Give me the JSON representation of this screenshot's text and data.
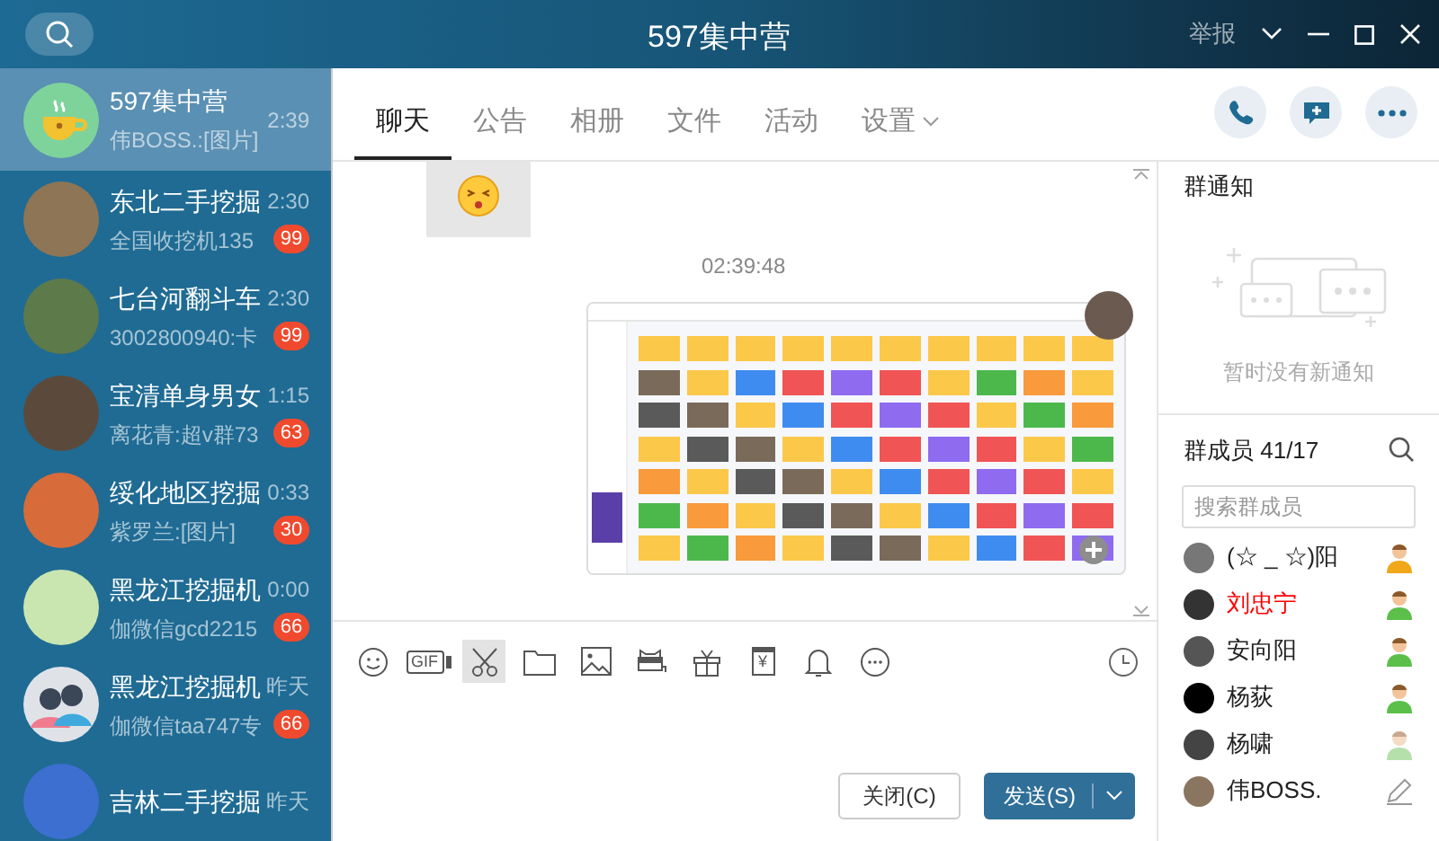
{
  "window": {
    "title": "597集中营",
    "report": "举报"
  },
  "conversations": [
    {
      "name": "597集中营",
      "time": "2:39",
      "preview": "伟BOSS.:[图片]",
      "selected": true,
      "kind": "cup"
    },
    {
      "name": "东北二手挖掘",
      "time": "2:30",
      "preview": "全国收挖机135",
      "badge": "99",
      "selected": false,
      "kind": "photo"
    },
    {
      "name": "七台河翻斗车",
      "time": "2:30",
      "preview": "3002800940:卡",
      "badge": "99",
      "selected": false,
      "kind": "photo"
    },
    {
      "name": "宝清单身男女",
      "time": "1:15",
      "preview": "离花青:超v群73",
      "badge": "63",
      "selected": false,
      "kind": "photo"
    },
    {
      "name": "绥化地区挖掘",
      "time": "0:33",
      "preview": "紫罗兰:[图片]",
      "badge": "30",
      "selected": false,
      "kind": "photo"
    },
    {
      "name": "黑龙江挖掘机",
      "time": "0:00",
      "preview": "伽微信gcd2215",
      "badge": "66",
      "selected": false,
      "kind": "photo"
    },
    {
      "name": "黑龙江挖掘机",
      "time": "昨天",
      "preview": "伽微信taa747专",
      "badge": "66",
      "selected": false,
      "kind": "people"
    },
    {
      "name": "吉林二手挖掘",
      "time": "昨天",
      "selected": false,
      "kind": "photo"
    }
  ],
  "tabs": [
    {
      "label": "聊天",
      "selected": true
    },
    {
      "label": "公告",
      "selected": false
    },
    {
      "label": "相册",
      "selected": false
    },
    {
      "label": "文件",
      "selected": false
    },
    {
      "label": "活动",
      "selected": false
    },
    {
      "label": "设置",
      "selected": false,
      "dropdown": true
    }
  ],
  "chat": {
    "timestamp": "02:39:48"
  },
  "composer": {
    "tools": [
      {
        "kind": "emoji"
      },
      {
        "kind": "gif",
        "label": "GIF"
      },
      {
        "kind": "scissors",
        "selected": true
      },
      {
        "kind": "folder"
      },
      {
        "kind": "image"
      },
      {
        "kind": "screen"
      },
      {
        "kind": "gift"
      },
      {
        "kind": "redpacket",
        "label": "¥"
      },
      {
        "kind": "bell"
      },
      {
        "kind": "more"
      }
    ],
    "close_button": "关闭(C)",
    "send_button": "发送(S)"
  },
  "notice": {
    "title": "群通知",
    "empty_text": "暂时没有新通知"
  },
  "members": {
    "title": "群成员 41/17",
    "search_placeholder": "搜索群成员",
    "list": [
      {
        "name": "(☆ _ ☆)阳",
        "kind": "owner",
        "highlighted": false
      },
      {
        "name": "刘忠宁",
        "kind": "admin",
        "highlighted": true
      },
      {
        "name": "安向阳",
        "kind": "admin",
        "highlighted": false
      },
      {
        "name": "杨荻",
        "kind": "admin",
        "highlighted": false
      },
      {
        "name": "杨啸",
        "kind": "member",
        "highlighted": false
      },
      {
        "name": "伟BOSS.",
        "kind": "self",
        "highlighted": false
      }
    ]
  }
}
